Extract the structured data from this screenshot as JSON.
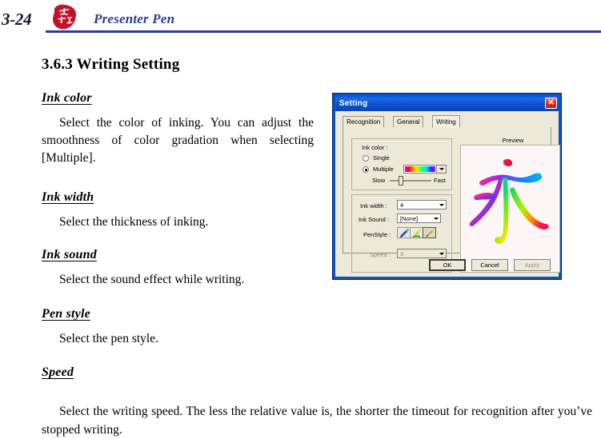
{
  "header": {
    "page_number": "3-24",
    "title": "Presenter Pen",
    "logo_icon": "red-seal-logo-icon",
    "rule_color": "#2b3d9c",
    "title_color": "#2b3d9c"
  },
  "section": {
    "heading": "3.6.3 Writing Setting"
  },
  "blocks": [
    {
      "heading": "Ink color",
      "body": "Select the color of inking. You can adjust the smoothness of color gradation when selecting [Multiple]."
    },
    {
      "heading": "Ink width",
      "body": "Select the thickness of inking."
    },
    {
      "heading": "Ink sound",
      "body": "Select the sound effect while writing."
    },
    {
      "heading": "Pen style",
      "body": "Select the pen style."
    },
    {
      "heading": "Speed",
      "body": "Select the writing speed. The less the relative value is, the shorter the timeout for recognition after you’ve stopped writing."
    }
  ],
  "dialog": {
    "title": "Setting",
    "close_icon": "close-icon",
    "titlebar_color": "#0b52cf",
    "close_button_color": "#d6301c",
    "tabs": [
      {
        "label": "Recognition",
        "active": false
      },
      {
        "label": "General",
        "active": false
      },
      {
        "label": "Writing",
        "active": true
      }
    ],
    "ink_color_group": {
      "label": "Ink color :",
      "options": [
        {
          "label": "Single",
          "selected": false
        },
        {
          "label": "Multiple",
          "selected": true
        }
      ],
      "gradient_combo": {
        "icon": "chevron-down-icon",
        "swatch": "rainbow-spectrum"
      },
      "slider": {
        "min_label": "Slow",
        "max_label": "Fast",
        "position_percent": 27
      }
    },
    "params_group": {
      "ink_width": {
        "label": "Ink width :",
        "value": "4",
        "disabled": false
      },
      "ink_sound": {
        "label": "Ink Sound :",
        "value": "[None]",
        "disabled": false
      },
      "pen_style": {
        "label": "PenStyle :",
        "buttons": [
          {
            "icon": "blue-pen-icon",
            "selected": false
          },
          {
            "icon": "green-brush-icon",
            "selected": false
          },
          {
            "icon": "dark-brush-icon",
            "selected": true
          }
        ]
      },
      "speed": {
        "label": "Speed :",
        "value": "3",
        "disabled": true
      }
    },
    "preview": {
      "label": "Preview",
      "content": "永",
      "description": "rainbow-gradient-chinese-character"
    },
    "buttons": [
      {
        "label": "OK",
        "default": true,
        "disabled": false
      },
      {
        "label": "Cancel",
        "default": false,
        "disabled": false
      },
      {
        "label": "Apply",
        "default": false,
        "disabled": true
      }
    ]
  }
}
